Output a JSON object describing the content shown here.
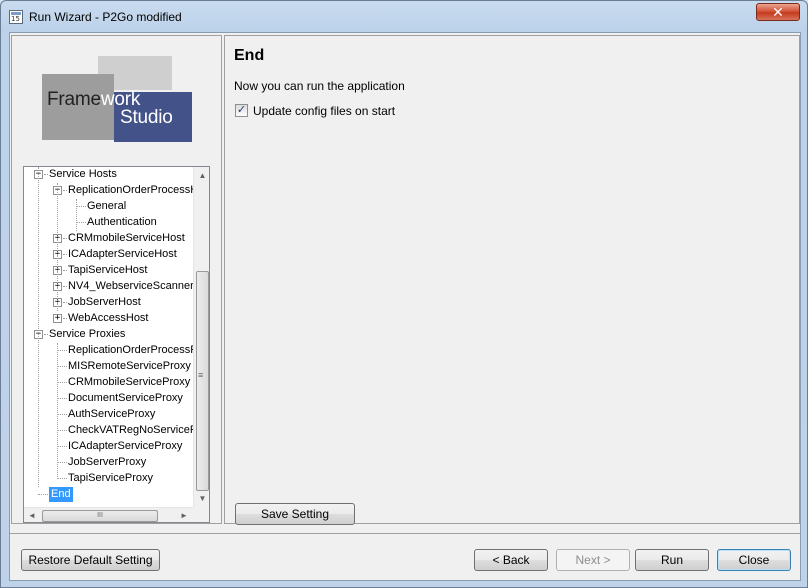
{
  "window": {
    "title": "Run Wizard - P2Go modified",
    "close_label": "✕"
  },
  "logo": {
    "part1": "Frame",
    "part2": "work",
    "part3": "Studio"
  },
  "tree": {
    "items": [
      {
        "label": "Service Hosts",
        "level": 0,
        "expander": "−"
      },
      {
        "label": "ReplicationOrderProcessH",
        "level": 1,
        "expander": "−"
      },
      {
        "label": "General",
        "level": 2
      },
      {
        "label": "Authentication",
        "level": 2
      },
      {
        "label": "CRMmobileServiceHost",
        "level": 1,
        "expander": "+"
      },
      {
        "label": "ICAdapterServiceHost",
        "level": 1,
        "expander": "+"
      },
      {
        "label": "TapiServiceHost",
        "level": 1,
        "expander": "+"
      },
      {
        "label": "NV4_WebserviceScanner",
        "level": 1,
        "expander": "+"
      },
      {
        "label": "JobServerHost",
        "level": 1,
        "expander": "+"
      },
      {
        "label": "WebAccessHost",
        "level": 1,
        "expander": "+"
      },
      {
        "label": "Service Proxies",
        "level": 0,
        "expander": "−"
      },
      {
        "label": "ReplicationOrderProcessPr",
        "level": 1
      },
      {
        "label": "MISRemoteServiceProxy",
        "level": 1
      },
      {
        "label": "CRMmobileServiceProxy",
        "level": 1
      },
      {
        "label": "DocumentServiceProxy",
        "level": 1
      },
      {
        "label": "AuthServiceProxy",
        "level": 1
      },
      {
        "label": "CheckVATRegNoServiceF",
        "level": 1
      },
      {
        "label": "ICAdapterServiceProxy",
        "level": 1
      },
      {
        "label": "JobServerProxy",
        "level": 1
      },
      {
        "label": "TapiServiceProxy",
        "level": 1
      },
      {
        "label": "End",
        "level": 0,
        "selected": true
      }
    ],
    "scroll": {
      "up": "▲",
      "down": "▼",
      "left": "◄",
      "right": "►",
      "vgrip": "≡",
      "hgrip": "III"
    }
  },
  "page": {
    "title": "End",
    "description": "Now you can run the application",
    "checkbox_label": "Update config files on start",
    "checkbox_checked": true,
    "checkbox_mark": "✓",
    "save_setting": "Save Setting"
  },
  "footer": {
    "restore": "Restore Default Setting",
    "back": "< Back",
    "next": "Next >",
    "run": "Run",
    "close": "Close"
  }
}
